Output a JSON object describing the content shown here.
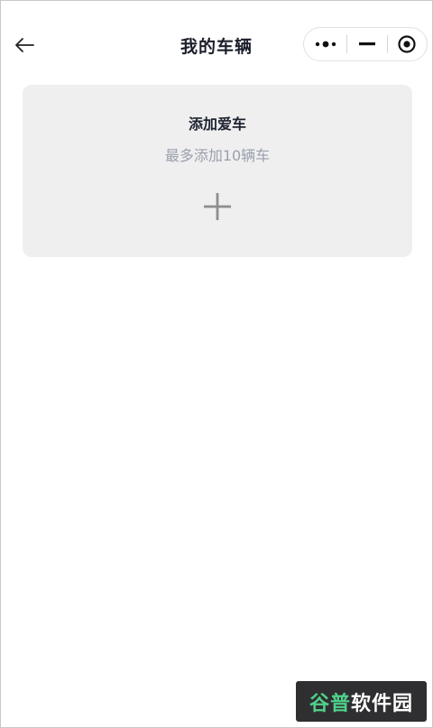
{
  "header": {
    "title": "我的车辆",
    "back_icon": "arrow-left-icon",
    "capsule": {
      "more_icon": "more-dots-icon",
      "minimize_icon": "minimize-icon",
      "close_icon": "target-circle-icon"
    }
  },
  "card": {
    "title": "添加爱车",
    "subtitle": "最多添加10辆车",
    "add_icon": "plus-icon"
  },
  "watermark": {
    "part1": "谷普",
    "part2": "软件园"
  },
  "colors": {
    "background": "#ffffff",
    "card_bg": "#efeff0",
    "title": "#1b1f2a",
    "subtitle": "#9aa0ab",
    "watermark_green": "#4fd18b"
  }
}
